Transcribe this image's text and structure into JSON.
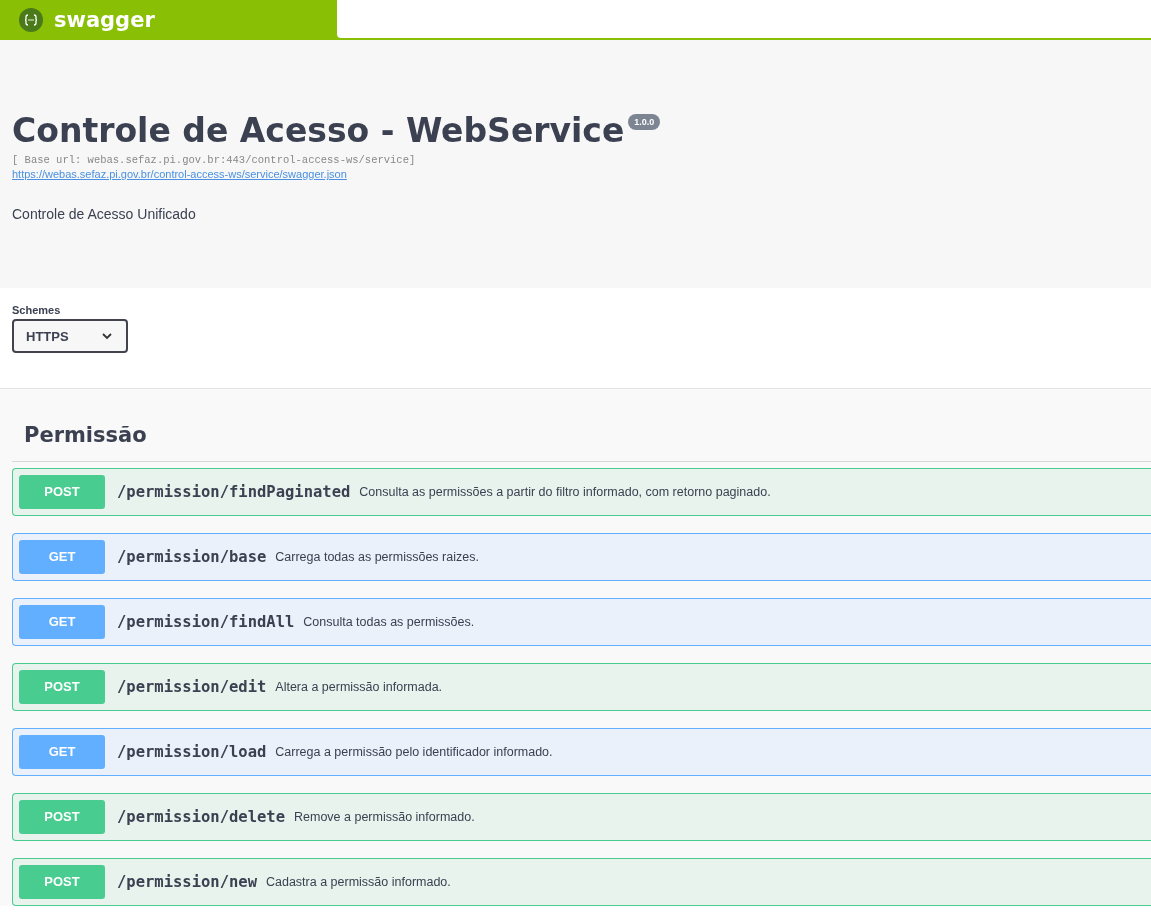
{
  "topbar": {
    "logo_text": "swagger"
  },
  "info": {
    "title": "Controle de Acesso - WebService",
    "version": "1.0.0",
    "base_url": "[ Base url: webas.sefaz.pi.gov.br:443/control-access-ws/service]",
    "spec_link": "https://webas.sefaz.pi.gov.br/control-access-ws/service/swagger.json",
    "description": "Controle de Acesso Unificado"
  },
  "schemes": {
    "label": "Schemes",
    "value": "HTTPS"
  },
  "tag": {
    "name": "Permissão"
  },
  "operations": [
    {
      "method": "POST",
      "path": "/permission/findPaginated",
      "summary": "Consulta as permissões a partir do filtro informado, com retorno paginado."
    },
    {
      "method": "GET",
      "path": "/permission/base",
      "summary": "Carrega todas as permissões raizes."
    },
    {
      "method": "GET",
      "path": "/permission/findAll",
      "summary": "Consulta todas as permissões."
    },
    {
      "method": "POST",
      "path": "/permission/edit",
      "summary": "Altera a permissão informada."
    },
    {
      "method": "GET",
      "path": "/permission/load",
      "summary": "Carrega a permissão pelo identificador informado."
    },
    {
      "method": "POST",
      "path": "/permission/delete",
      "summary": "Remove a permissão informado."
    },
    {
      "method": "POST",
      "path": "/permission/new",
      "summary": "Cadastra a permissão informado."
    }
  ]
}
